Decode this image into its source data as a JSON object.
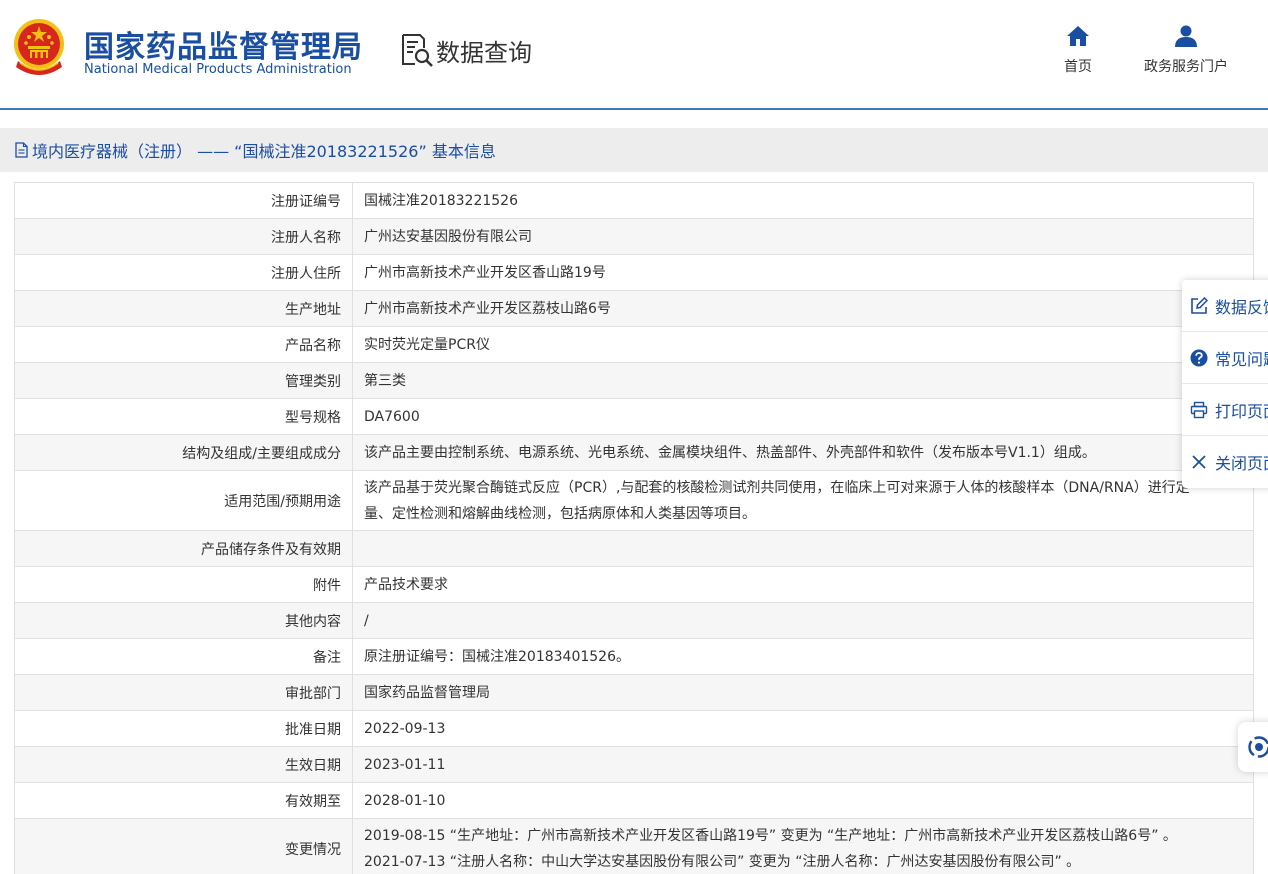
{
  "header": {
    "brand_cn": "国家药品监督管理局",
    "brand_en": "National Medical Products Administration",
    "section_title": "数据查询",
    "nav": {
      "home": "首页",
      "portal": "政务服务门户"
    }
  },
  "titlebar": {
    "text": "境内医疗器械（注册） —— “国械注准20183221526” 基本信息"
  },
  "rows": [
    {
      "label": "注册证编号",
      "value": "国械注准20183221526"
    },
    {
      "label": "注册人名称",
      "value": "广州达安基因股份有限公司"
    },
    {
      "label": "注册人住所",
      "value": "广州市高新技术产业开发区香山路19号"
    },
    {
      "label": "生产地址",
      "value": "广州市高新技术产业开发区荔枝山路6号"
    },
    {
      "label": "产品名称",
      "value": "实时荧光定量PCR仪"
    },
    {
      "label": "管理类别",
      "value": "第三类"
    },
    {
      "label": "型号规格",
      "value": "DA7600"
    },
    {
      "label": "结构及组成/主要组成成分",
      "value": "该产品主要由控制系统、电源系统、光电系统、金属模块组件、热盖部件、外壳部件和软件（发布版本号V1.1）组成。"
    },
    {
      "label": "适用范围/预期用途",
      "value_line1": "该产品基于荧光聚合酶链式反应（PCR）,与配套的核酸检测试剂共同使用，在临床上可对来源于人体的核酸样本（DNA/RNA）进行定",
      "value_line2": "量、定性检测和熔解曲线检测，包括病原体和人类基因等项目。"
    },
    {
      "label": "产品储存条件及有效期",
      "value": ""
    },
    {
      "label": "附件",
      "value": "产品技术要求"
    },
    {
      "label": "其他内容",
      "value": "/"
    },
    {
      "label": "备注",
      "value": "原注册证编号：国械注准20183401526。"
    },
    {
      "label": "审批部门",
      "value": "国家药品监督管理局"
    },
    {
      "label": "批准日期",
      "value": "2022-09-13"
    },
    {
      "label": "生效日期",
      "value": "2023-01-11"
    },
    {
      "label": "有效期至",
      "value": "2028-01-10"
    },
    {
      "label": "变更情况",
      "value_line1": "2019-08-15 “生产地址：广州市高新技术产业开发区香山路19号” 变更为 “生产地址：广州市高新技术产业开发区荔枝山路6号” 。",
      "value_line2": "2021-07-13 “注册人名称：中山大学达安基因股份有限公司” 变更为 “注册人名称：广州达安基因股份有限公司” 。"
    }
  ],
  "float_panel": {
    "feedback": "数据反馈",
    "faq": "常见问题",
    "print": "打印页面",
    "close": "关闭页面"
  },
  "colors": {
    "brand_blue": "#1a4ea1",
    "header_line": "#3f78c6",
    "title_bg": "#ededed",
    "emblem_red": "#d7261c",
    "emblem_gold": "#f3c013"
  },
  "icons": {
    "emblem": "national-emblem-icon",
    "query": "document-search-icon",
    "home": "home-icon",
    "portal": "user-icon",
    "doc": "document-icon",
    "feedback": "edit-icon",
    "faq": "question-circle-icon",
    "print": "printer-icon",
    "close": "close-icon",
    "assistant": "assistant-icon"
  }
}
